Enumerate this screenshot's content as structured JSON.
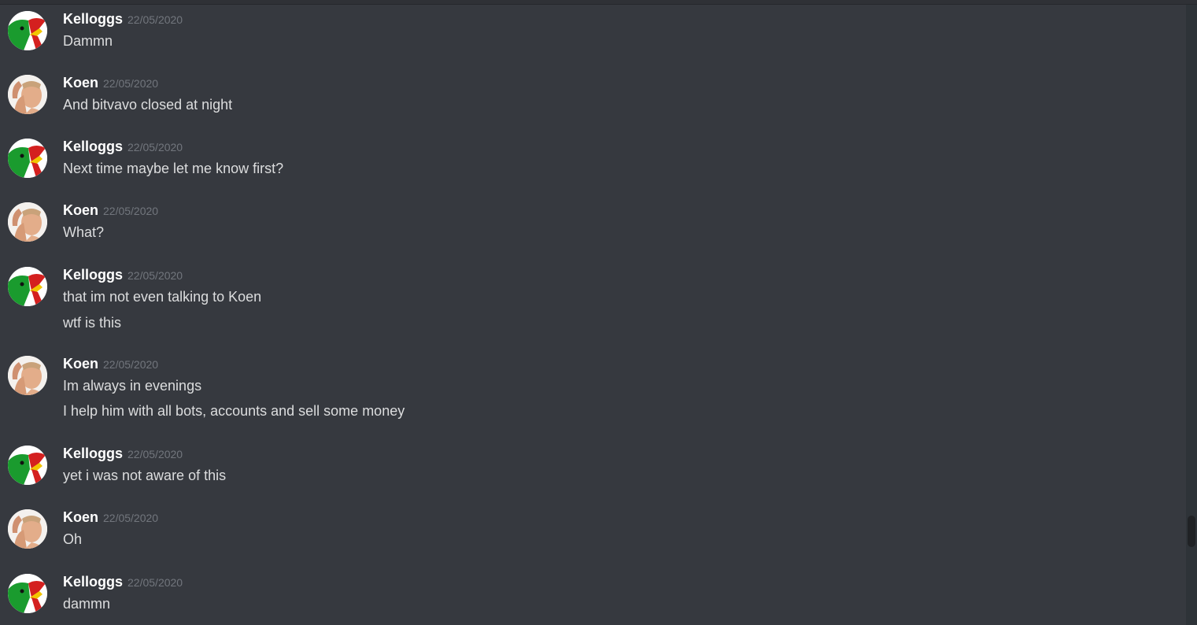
{
  "messages": [
    {
      "author": "Kelloggs",
      "avatar": "kelloggs-avatar",
      "timestamp": "22/05/2020",
      "lines": [
        "Dammn"
      ]
    },
    {
      "author": "Koen",
      "avatar": "koen-avatar",
      "timestamp": "22/05/2020",
      "lines": [
        "And bitvavo closed at night"
      ]
    },
    {
      "author": "Kelloggs",
      "avatar": "kelloggs-avatar",
      "timestamp": "22/05/2020",
      "lines": [
        "Next time maybe let me know first?"
      ]
    },
    {
      "author": "Koen",
      "avatar": "koen-avatar",
      "timestamp": "22/05/2020",
      "lines": [
        "What?"
      ]
    },
    {
      "author": "Kelloggs",
      "avatar": "kelloggs-avatar",
      "timestamp": "22/05/2020",
      "lines": [
        "that im not even talking to Koen",
        "wtf is this"
      ]
    },
    {
      "author": "Koen",
      "avatar": "koen-avatar",
      "timestamp": "22/05/2020",
      "lines": [
        "Im always in evenings",
        "I help him with all bots, accounts and sell some money"
      ]
    },
    {
      "author": "Kelloggs",
      "avatar": "kelloggs-avatar",
      "timestamp": "22/05/2020",
      "lines": [
        "yet i was not aware of this"
      ]
    },
    {
      "author": "Koen",
      "avatar": "koen-avatar",
      "timestamp": "22/05/2020",
      "lines": [
        "Oh"
      ]
    },
    {
      "author": "Kelloggs",
      "avatar": "kelloggs-avatar",
      "timestamp": "22/05/2020",
      "lines": [
        "dammn"
      ]
    }
  ],
  "colors": {
    "background": "#36393f",
    "username": "#ffffff",
    "timestamp": "#72767d",
    "message_text": "#dcddde",
    "kelloggs_green": "#1a9b2e",
    "kelloggs_red": "#d4201f"
  }
}
